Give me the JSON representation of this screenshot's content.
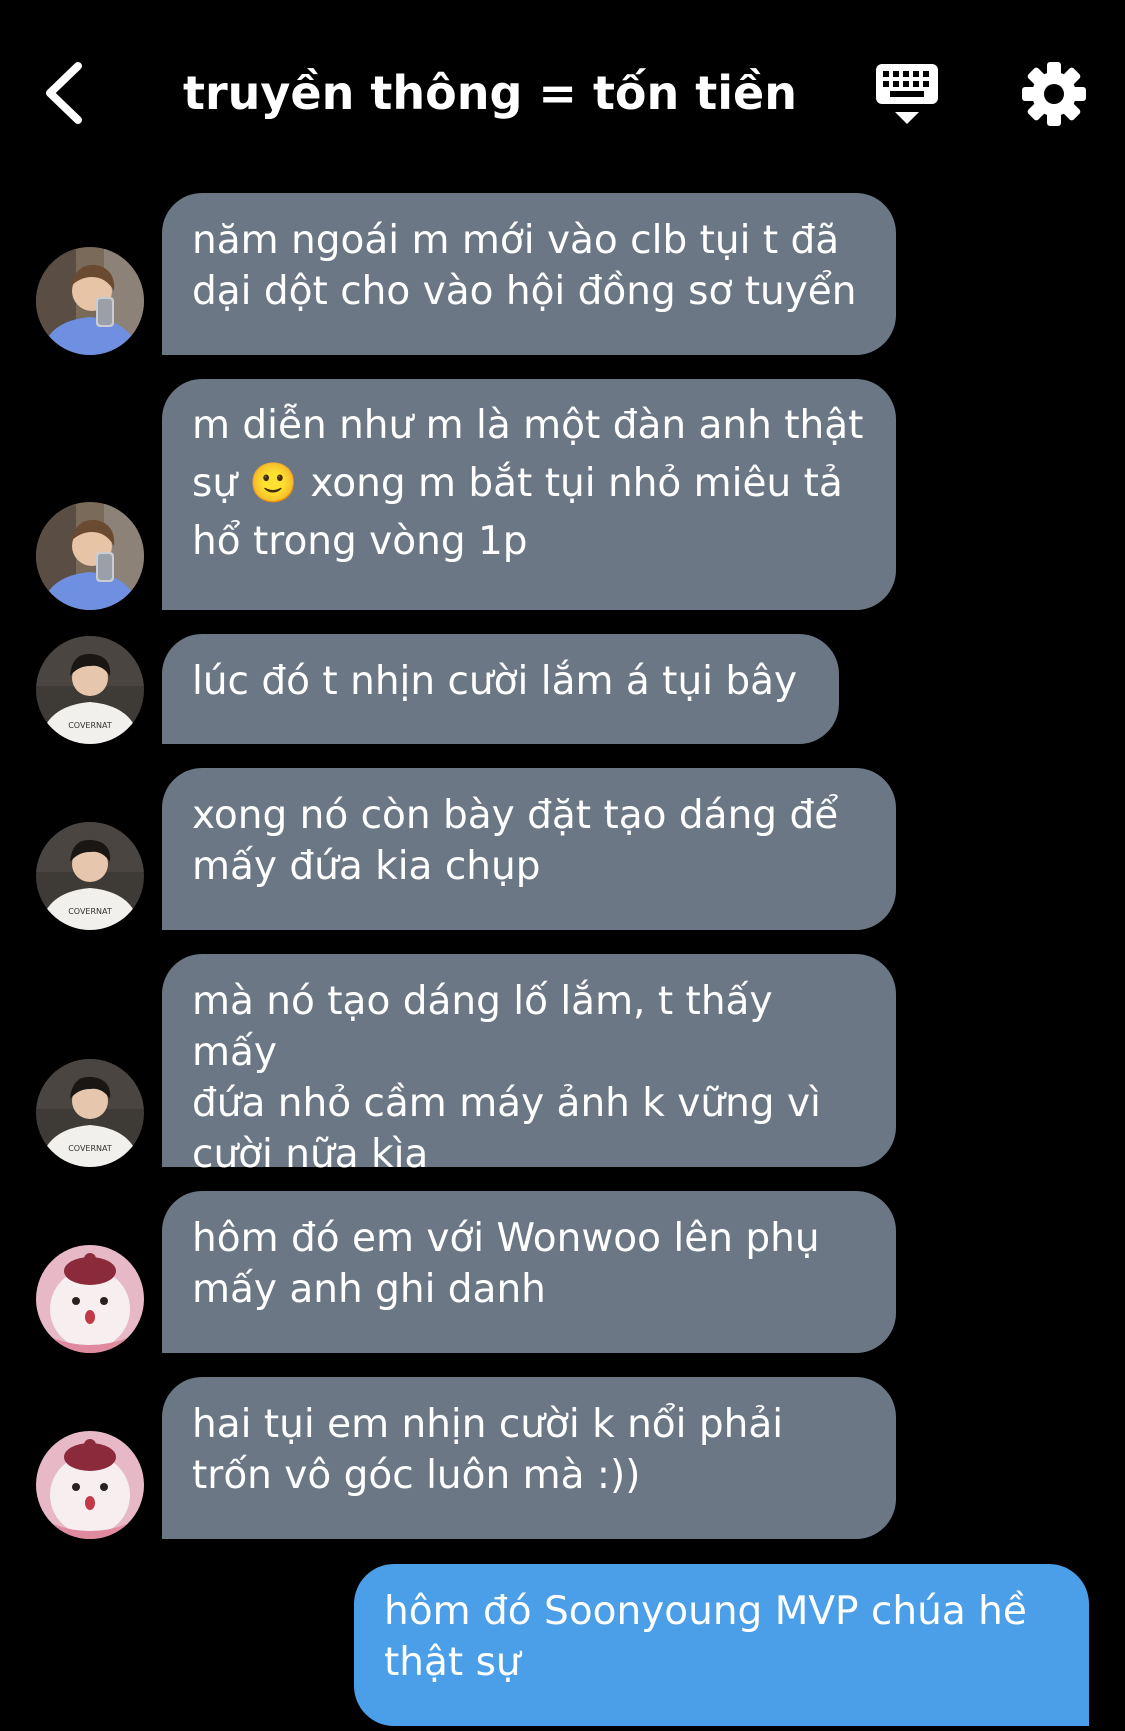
{
  "header": {
    "title": "truyền thông = tốn tiền"
  },
  "icons": {
    "back": "chevron-left-icon",
    "keyboard": "keyboard-icon",
    "settings": "gear-icon"
  },
  "colors": {
    "background": "#000000",
    "incoming_bubble": "#6b7785",
    "outgoing_bubble": "#4b9ee8",
    "text": "#ffffff"
  },
  "messages": [
    {
      "sender": "incoming",
      "avatar": "avatar-boy-mirror-selfie",
      "text": "năm ngoái m mới vào clb tụi t đã\ndại dột cho vào hội đồng sơ tuyển"
    },
    {
      "sender": "incoming",
      "avatar": "avatar-boy-mirror-selfie",
      "text": "m diễn như m là một đàn anh thật\nsự 🙂 xong m bắt tụi nhỏ miêu tả\nhổ trong vòng 1p"
    },
    {
      "sender": "incoming",
      "avatar": "avatar-boy-white-shirt",
      "text": "lúc đó t nhịn cười lắm á tụi bây"
    },
    {
      "sender": "incoming",
      "avatar": "avatar-boy-white-shirt",
      "text": "xong nó còn bày đặt tạo dáng để\nmấy đứa kia chụp"
    },
    {
      "sender": "incoming",
      "avatar": "avatar-boy-white-shirt",
      "text": "mà nó tạo dáng lố lắm, t thấy mấy\nđứa nhỏ cầm máy ảnh k vững vì\ncười nữa kìa"
    },
    {
      "sender": "incoming",
      "avatar": "avatar-pink-plush",
      "text": "hôm đó em với Wonwoo lên phụ\nmấy anh ghi danh"
    },
    {
      "sender": "incoming",
      "avatar": "avatar-pink-plush",
      "text": "hai tụi em nhịn cười k nổi phải\ntrốn vô góc luôn mà :))"
    },
    {
      "sender": "outgoing",
      "text": "hôm đó Soonyoung MVP chúa hề\nthật sự"
    }
  ]
}
